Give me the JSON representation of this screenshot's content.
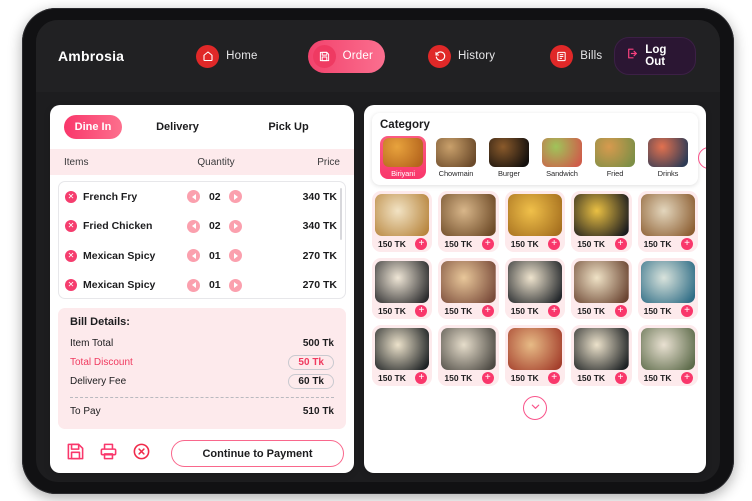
{
  "app": {
    "brand": "Ambrosia"
  },
  "nav": {
    "items": [
      {
        "label": "Home",
        "icon": "home-icon",
        "active": false
      },
      {
        "label": "Order",
        "icon": "save-icon",
        "active": true
      },
      {
        "label": "History",
        "icon": "history-icon",
        "active": false
      },
      {
        "label": "Bills",
        "icon": "receipt-icon",
        "active": false
      }
    ],
    "logout": {
      "label": "Log Out",
      "icon": "logout-icon"
    }
  },
  "order_panel": {
    "mode_tabs": [
      {
        "label": "Dine In",
        "active": true
      },
      {
        "label": "Delivery",
        "active": false
      },
      {
        "label": "Pick Up",
        "active": false
      }
    ],
    "table_headers": {
      "items": "Items",
      "quantity": "Quantity",
      "price": "Price"
    },
    "items": [
      {
        "name": "French Fry",
        "qty": "02",
        "price": "340 TK"
      },
      {
        "name": "Fried Chicken",
        "qty": "02",
        "price": "340 TK"
      },
      {
        "name": "Mexican Spicy",
        "qty": "01",
        "price": "270 TK"
      },
      {
        "name": "Mexican Spicy",
        "qty": "01",
        "price": "270 TK"
      }
    ],
    "bill": {
      "title": "Bill Details:",
      "rows": [
        {
          "label": "Item Total",
          "value": "500 Tk",
          "chip": false,
          "accent": false
        },
        {
          "label": "Total Discount",
          "value": "50 Tk",
          "chip": true,
          "accent": true
        },
        {
          "label": "Delivery Fee",
          "value": "60 Tk",
          "chip": true,
          "accent": false
        }
      ],
      "total_label": "To Pay",
      "total_value": "510 Tk"
    },
    "actions": {
      "save": "save-icon",
      "print": "print-icon",
      "cancel": "cancel-icon",
      "continue_label": "Continue to Payment"
    }
  },
  "menu_panel": {
    "category_title": "Category",
    "categories": [
      {
        "label": "Biriyani",
        "active": true,
        "c1": "#e8a33d",
        "c2": "#b5651d"
      },
      {
        "label": "Chowmain",
        "active": false,
        "c1": "#c9a06b",
        "c2": "#6b4a2a"
      },
      {
        "label": "Burger",
        "active": false,
        "c1": "#8a5a2b",
        "c2": "#14100d"
      },
      {
        "label": "Sandwich",
        "active": false,
        "c1": "#9fc45a",
        "c2": "#cf5d4a"
      },
      {
        "label": "Fried",
        "active": false,
        "c1": "#d79a4e",
        "c2": "#7d8f46"
      },
      {
        "label": "Drinks",
        "active": false,
        "c1": "#e2714f",
        "c2": "#2e3b55"
      }
    ],
    "next_icon": "chevron-right-icon",
    "scroll_more_icon": "chevron-down-icon",
    "food_items": [
      {
        "price": "150 TK",
        "c1": "#f2e3c4",
        "c2": "#b8863f"
      },
      {
        "price": "150 TK",
        "c1": "#d8b68a",
        "c2": "#6e4b28"
      },
      {
        "price": "150 TK",
        "c1": "#f0c04a",
        "c2": "#a6701f"
      },
      {
        "price": "150 TK",
        "c1": "#eac043",
        "c2": "#1c1c1e"
      },
      {
        "price": "150 TK",
        "c1": "#e3d6bd",
        "c2": "#8d5f33"
      },
      {
        "price": "150 TK",
        "c1": "#efe6d6",
        "c2": "#2b2b2d"
      },
      {
        "price": "150 TK",
        "c1": "#e8c79a",
        "c2": "#7a4b3a"
      },
      {
        "price": "150 TK",
        "c1": "#eee3cd",
        "c2": "#23272b"
      },
      {
        "price": "150 TK",
        "c1": "#efe2c6",
        "c2": "#6b4532"
      },
      {
        "price": "150 TK",
        "c1": "#d9e3dc",
        "c2": "#2f6d86"
      },
      {
        "price": "150 TK",
        "c1": "#ece2cb",
        "c2": "#1e2224"
      },
      {
        "price": "150 TK",
        "c1": "#e6ddcb",
        "c2": "#4d4a44"
      },
      {
        "price": "150 TK",
        "c1": "#e7bb86",
        "c2": "#a43f2c"
      },
      {
        "price": "150 TK",
        "c1": "#ece2cb",
        "c2": "#1e2224"
      },
      {
        "price": "150 TK",
        "c1": "#e9e1d2",
        "c2": "#5d6b4a"
      }
    ]
  },
  "colors": {
    "accent_pink": "#f9376b",
    "accent_light": "#fdeaec",
    "red_badge": "#e02828",
    "nav_dark": "#212123",
    "frame_dark": "#111113"
  }
}
